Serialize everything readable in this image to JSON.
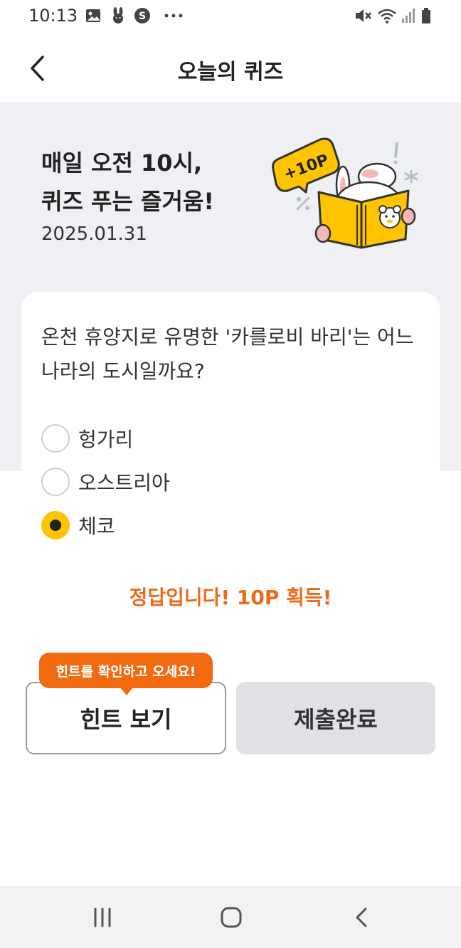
{
  "status_bar": {
    "time": "10:13",
    "left_icons": [
      "gallery-icon",
      "bunny-icon",
      "s-circle-icon",
      "more-dots-icon"
    ],
    "right_icons": [
      "mute-icon",
      "wifi-icon",
      "signal-icon",
      "battery-icon"
    ]
  },
  "header": {
    "title": "오늘의 퀴즈",
    "back_icon": "chevron-left-icon"
  },
  "hero": {
    "title_line1": "매일 오전 10시,",
    "title_line2": "퀴즈 푸는 즐거움!",
    "date": "2025.01.31",
    "badge": "+10P"
  },
  "quiz": {
    "question": "온천 휴양지로 유명한 '카를로비 바리'는 어느 나라의 도시일까요?",
    "options": [
      {
        "label": "헝가리",
        "selected": false
      },
      {
        "label": "오스트리아",
        "selected": false
      },
      {
        "label": "체코",
        "selected": true
      }
    ],
    "result": "정답입니다! 10P 획득!"
  },
  "actions": {
    "hint_tooltip": "힌트를 확인하고 오세요!",
    "hint_label": "힌트 보기",
    "submit_label": "제출완료"
  },
  "nav": {
    "icons": [
      "recent-apps-icon",
      "home-icon",
      "back-icon"
    ]
  },
  "colors": {
    "accent_yellow": "#ffc400",
    "accent_orange": "#f26a10",
    "result_text": "#ee6a1b",
    "hero_bg": "#eef0f4",
    "submit_bg": "#dfe1e5"
  }
}
